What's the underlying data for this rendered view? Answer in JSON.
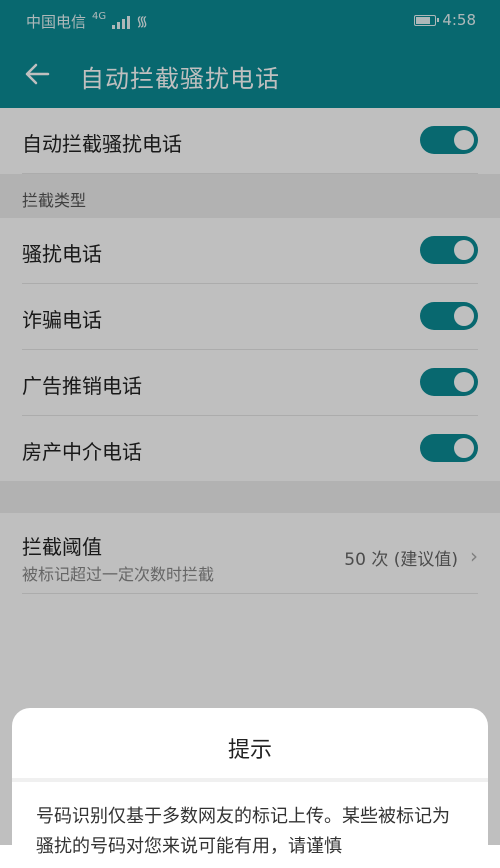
{
  "status_bar": {
    "carrier": "中国电信",
    "network": "4G",
    "time": "4:58"
  },
  "app_bar": {
    "title": "自动拦截骚扰电话"
  },
  "main_toggle": {
    "label": "自动拦截骚扰电话",
    "on": true
  },
  "section": {
    "header": "拦截类型",
    "items": [
      {
        "label": "骚扰电话",
        "on": true
      },
      {
        "label": "诈骗电话",
        "on": true
      },
      {
        "label": "广告推销电话",
        "on": true
      },
      {
        "label": "房产中介电话",
        "on": true
      }
    ]
  },
  "threshold": {
    "title": "拦截阈值",
    "subtitle": "被标记超过一定次数时拦截",
    "value": "50 次 (建议值)"
  },
  "dialog": {
    "title": "提示",
    "text": "号码识别仅基于多数网友的标记上传。某些被标记为骚扰的号码对您来说可能有用，请谨慎"
  },
  "colors": {
    "accent": "#0b8b95"
  }
}
